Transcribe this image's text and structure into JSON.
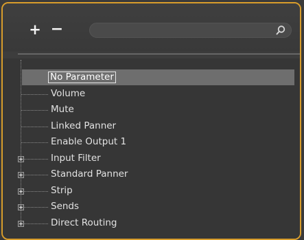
{
  "toolbar": {
    "add_label": "+",
    "remove_label": "−",
    "search": {
      "value": "",
      "placeholder": "",
      "icon": "search-icon"
    }
  },
  "colors": {
    "panel_border": "#d99d2b",
    "selection": "#6e6e6e",
    "text": "#e2e2e2"
  },
  "tree": {
    "items": [
      {
        "label": "No Parameter",
        "expandable": false,
        "selected": true
      },
      {
        "label": "Volume",
        "expandable": false,
        "selected": false
      },
      {
        "label": "Mute",
        "expandable": false,
        "selected": false
      },
      {
        "label": "Linked Panner",
        "expandable": false,
        "selected": false
      },
      {
        "label": "Enable Output 1",
        "expandable": false,
        "selected": false
      },
      {
        "label": "Input Filter",
        "expandable": true,
        "selected": false
      },
      {
        "label": "Standard Panner",
        "expandable": true,
        "selected": false
      },
      {
        "label": "Strip",
        "expandable": true,
        "selected": false
      },
      {
        "label": "Sends",
        "expandable": true,
        "selected": false
      },
      {
        "label": "Direct Routing",
        "expandable": true,
        "selected": false
      }
    ]
  }
}
